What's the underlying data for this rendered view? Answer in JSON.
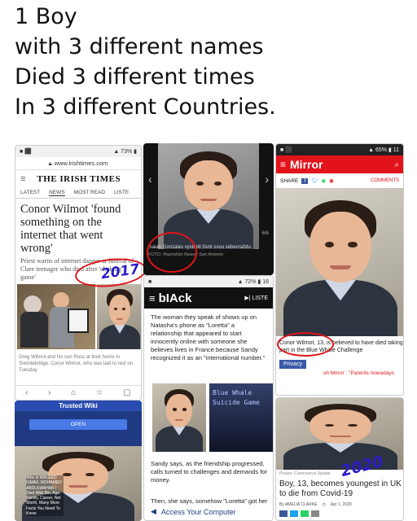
{
  "caption": {
    "line1": "1 Boy",
    "line2": "with 3 different names",
    "line3": "Died 3 different times",
    "line4": "In 3 different Countries."
  },
  "irish_times": {
    "url": "www.irishtimes.com",
    "masthead": "THE IRISH TIMES",
    "nav": [
      "LATEST",
      "NEWS",
      "MOST READ",
      "LISTE"
    ],
    "headline": "Conor Wilmot 'found something on the internet that went wrong'",
    "standfirst": "Priest warns of internet danger at funeral of Clare teenager who died after 'choking game'",
    "photo_caption": "Greg Wilmot and his son Ross at their home in Sixmilebridge. Conor Wilmot, who was laid to rest on Tuesday",
    "year_mark": "2017"
  },
  "center_top": {
    "caption": "Isaiah Gonzales vystrelil život svou sebevraždu.",
    "credit": "FOTO: Reprofoto News / San Antonio",
    "counter": "6/6"
  },
  "black": {
    "logo": "bIAck",
    "listen": "LISTE",
    "text1": "The woman they speak of shows up on Natasha's phone as \"Loretta\" a relationship that appeared to start innocently online with someone she believes lives in France because Sandy recognized it as an \"international number.\"",
    "game_title": "Blue Whale Suicide Game",
    "text2": "Sandy says, as the friendship progressed, calls turned to challenges and demands for money.",
    "text3": "Then, she says, somehow \"Loretta\" got her",
    "access": "Access Your Computer"
  },
  "mirror": {
    "logo": "Mirror",
    "share": "SHARE",
    "comments": "COMMENTS",
    "caption": "Conor Wilmot, 13, is believed to have died taking part in the Blue Whale Challenge",
    "privacy": "Privacy",
    "ticker": "sh Mirror : \"Parents nowadays"
  },
  "trusted": {
    "title": "Trusted Wiki",
    "open": "OPEN",
    "overlay": "Who is WALEED ISMAIL MOHAMED ABDULWAHAB | Died Wiki Bio, Age, Family, Career, Net Worth, Many More Facts You Need To Know"
  },
  "covid": {
    "picture_credit": "Picture: Coronavirus Update",
    "headline": "Boy, 13, becomes youngest in UK to die from Covid-19",
    "byline": "By AMELIA CLARKE",
    "date": "Apr 1, 2020",
    "year_mark": "2020"
  },
  "colors": {
    "red": "#e0151a",
    "mirror_red": "#e3131b",
    "ink": "#2b1bc9"
  }
}
